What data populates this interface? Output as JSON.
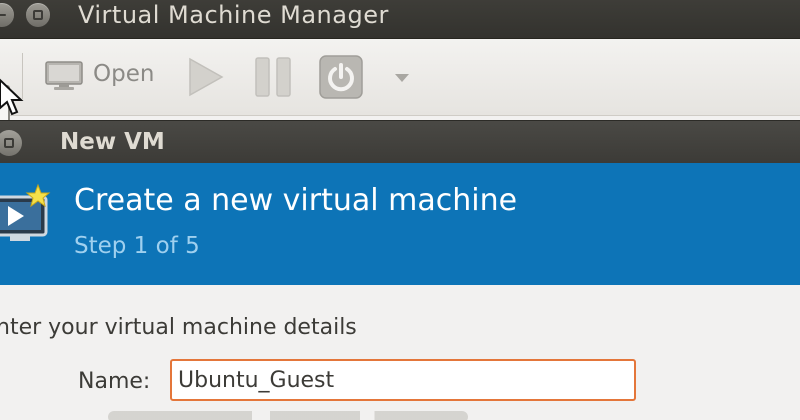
{
  "window": {
    "title": "Virtual Machine Manager"
  },
  "toolbar": {
    "open_label": "Open",
    "icons": [
      "monitor-icon",
      "play-icon",
      "pause-icon",
      "power-icon",
      "dropdown-icon"
    ]
  },
  "dialog": {
    "title": "New VM",
    "banner": {
      "title": "Create a new virtual machine",
      "step": "Step 1 of 5"
    },
    "section_heading": "nter your virtual machine details",
    "name_label": "Name:",
    "name_value": "Ubuntu_Guest"
  },
  "colors": {
    "titlebar": "#3c3b37",
    "banner": "#0d74b7",
    "focus_border": "#e4763a",
    "background": "#f2f1f0"
  }
}
